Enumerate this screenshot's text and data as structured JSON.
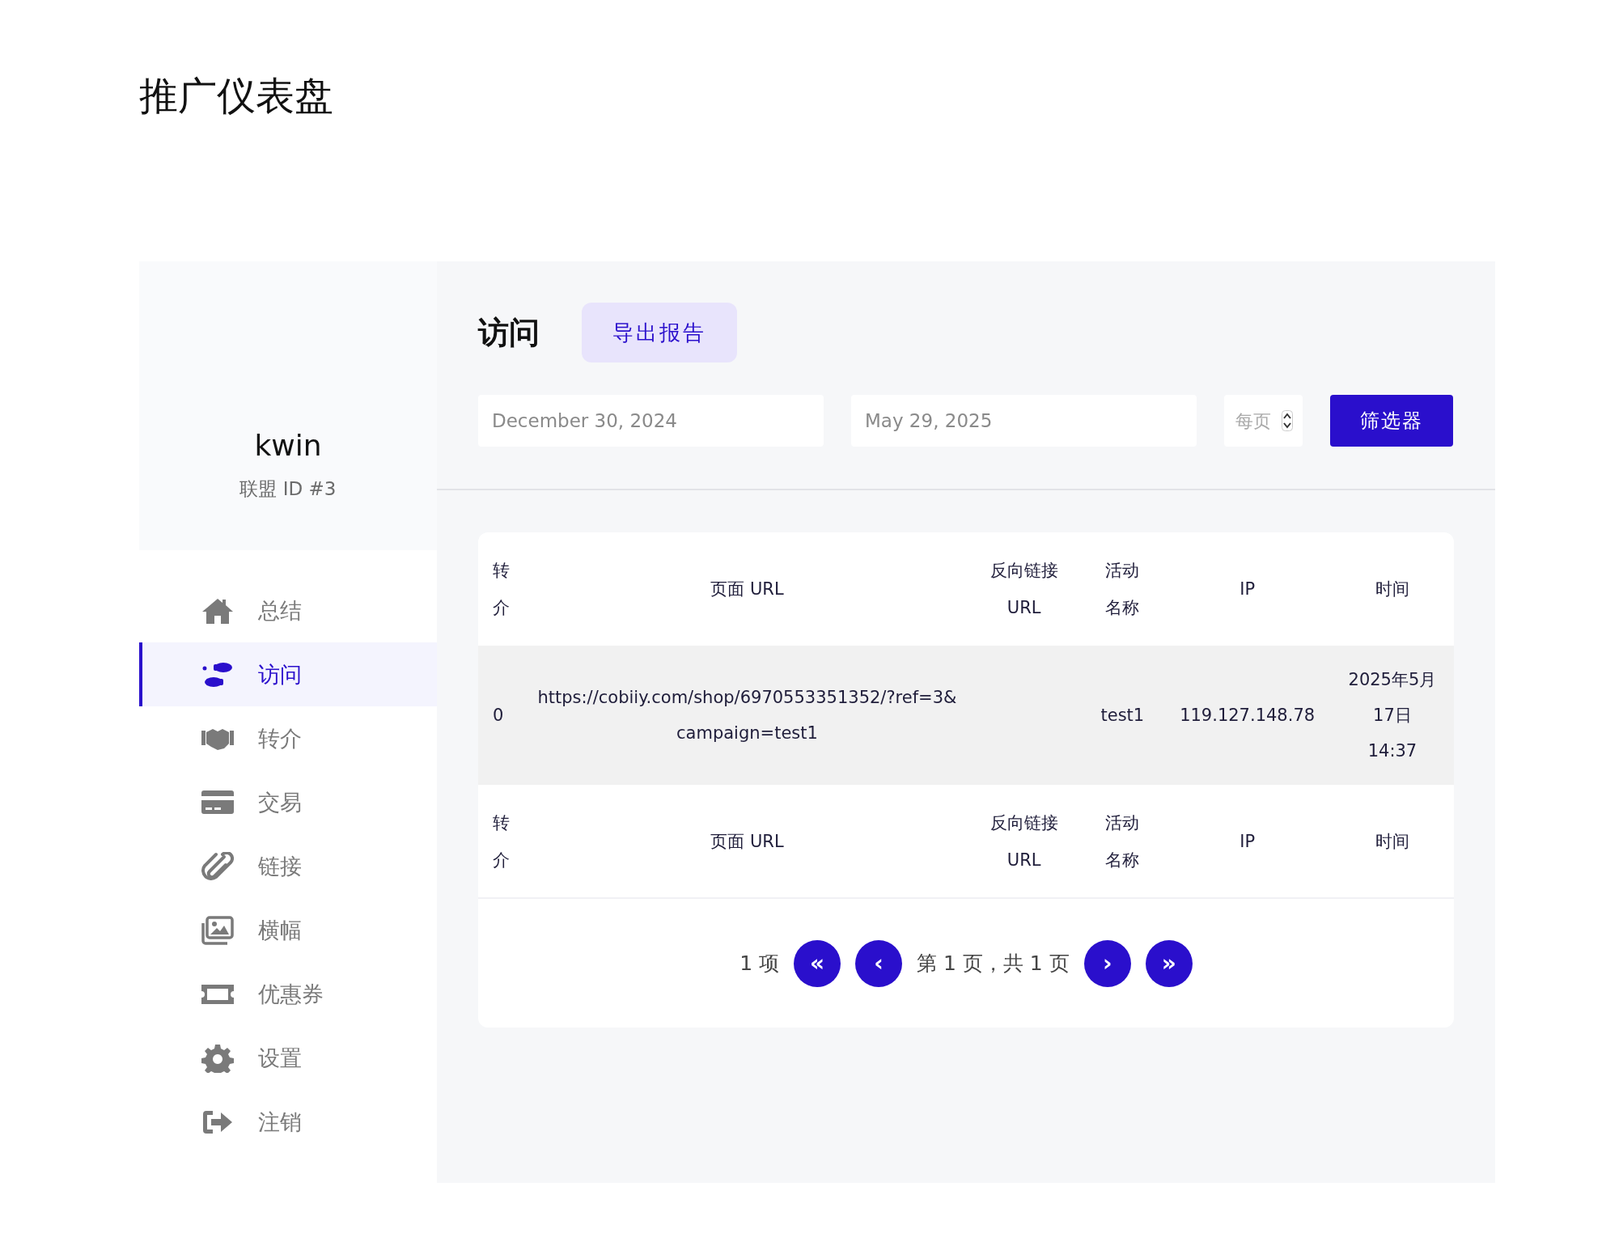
{
  "page_title": "推广仪表盘",
  "profile": {
    "name": "kwin",
    "affiliate_id": "联盟 ID #3"
  },
  "nav": [
    {
      "label": "总结",
      "selected": false
    },
    {
      "label": "访问",
      "selected": true
    },
    {
      "label": "转介",
      "selected": false
    },
    {
      "label": "交易",
      "selected": false
    },
    {
      "label": "链接",
      "selected": false
    },
    {
      "label": "横幅",
      "selected": false
    },
    {
      "label": "优惠券",
      "selected": false
    },
    {
      "label": "设置",
      "selected": false
    },
    {
      "label": "注销",
      "selected": false
    }
  ],
  "section": {
    "title": "访问",
    "export_button": "导出报告"
  },
  "filters": {
    "start_date": "December 30, 2024",
    "end_date": "May 29, 2025",
    "per_page": {
      "placeholder": "每页"
    },
    "button": "筛选器"
  },
  "table": {
    "columns": [
      "转介",
      "页面 URL",
      "反向链接 URL",
      "活动名称",
      "IP",
      "时间"
    ],
    "rows": [
      {
        "cells": [
          "0",
          "https://cobiiy.com/shop/6970553351352/?ref=3&campaign=test1",
          "",
          "test1",
          "119.127.148.78",
          "2025年5月17日 14:37"
        ]
      }
    ],
    "footer_columns": [
      "转介",
      "页面 URL",
      "反向链接 URL",
      "活动名称",
      "IP",
      "时间"
    ]
  },
  "pagination": {
    "count": "1 项",
    "first": "«",
    "prev": "‹",
    "page_info": "第 1 页，共 1 页",
    "next": "›",
    "last": "»"
  }
}
